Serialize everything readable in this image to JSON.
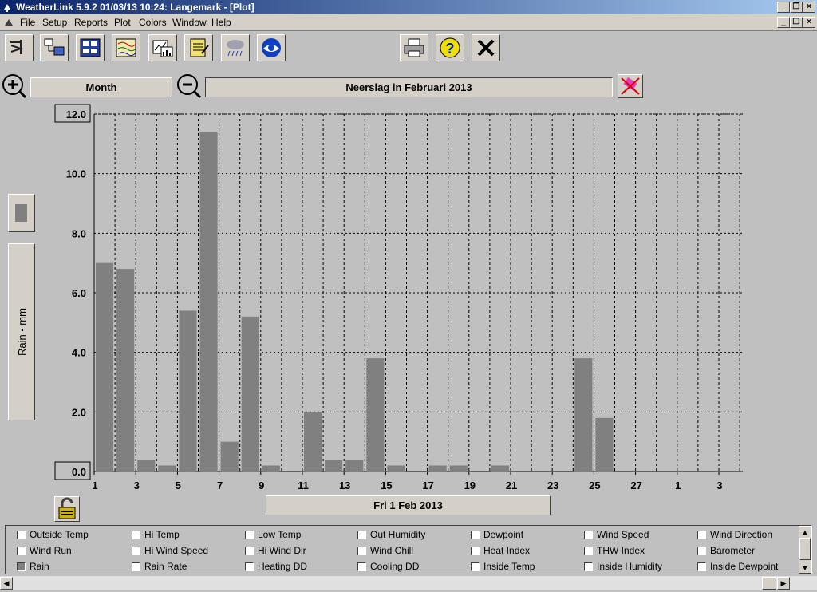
{
  "window": {
    "title": "WeatherLink 5.9.2  01/03/13  10:24: Langemark - [Plot]"
  },
  "menu": [
    "File",
    "Setup",
    "Reports",
    "Plot",
    "Colors",
    "Window",
    "Help"
  ],
  "toolbar": {
    "icons": [
      "station-icon",
      "setup-icon",
      "bulletin-icon",
      "strip-chart-icon",
      "plot-icon",
      "notes-icon",
      "rain-icon",
      "noaa-icon",
      "print-icon",
      "help-icon",
      "close-icon"
    ]
  },
  "plot": {
    "period": "Month",
    "title": "Neerslag in Februari 2013",
    "date_label": "Fri 1 Feb 2013",
    "ylabel": "Rain - mm"
  },
  "chart_data": {
    "type": "bar",
    "title": "Neerslag in Februari 2013",
    "ylabel": "Rain - mm",
    "xlabel": "Fri 1 Feb 2013",
    "ylim": [
      0,
      12
    ],
    "y_ticks": [
      "0.0",
      "2.0",
      "4.0",
      "6.0",
      "8.0",
      "10.0",
      "12.0"
    ],
    "x_ticks": [
      "1",
      "3",
      "5",
      "7",
      "9",
      "11",
      "13",
      "15",
      "17",
      "19",
      "21",
      "23",
      "25",
      "27",
      "1",
      "3"
    ],
    "values": [
      7.0,
      6.8,
      0.4,
      0.2,
      5.4,
      11.4,
      1.0,
      5.2,
      0.2,
      0.0,
      2.0,
      0.4,
      0.4,
      3.8,
      0.2,
      0.0,
      0.2,
      0.2,
      0.0,
      0.2,
      0.0,
      0.0,
      0.0,
      3.8,
      1.8,
      0.0,
      0.0,
      0.0,
      0.0,
      0.0,
      0.0
    ],
    "bar_color": "#808080",
    "grid": true
  },
  "series_options": [
    {
      "label": "Outside Temp",
      "checked": false
    },
    {
      "label": "Hi Temp",
      "checked": false
    },
    {
      "label": "Low Temp",
      "checked": false
    },
    {
      "label": "Out Humidity",
      "checked": false
    },
    {
      "label": "Dewpoint",
      "checked": false
    },
    {
      "label": "Wind Speed",
      "checked": false
    },
    {
      "label": "Wind Direction",
      "checked": false
    },
    {
      "label": "Wind Run",
      "checked": false
    },
    {
      "label": "Hi Wind Speed",
      "checked": false
    },
    {
      "label": "Hi Wind Dir",
      "checked": false
    },
    {
      "label": "Wind Chill",
      "checked": false
    },
    {
      "label": "Heat Index",
      "checked": false
    },
    {
      "label": "THW Index",
      "checked": false
    },
    {
      "label": "Barometer",
      "checked": false
    },
    {
      "label": "Rain",
      "checked": true
    },
    {
      "label": "Rain Rate",
      "checked": false
    },
    {
      "label": "Heating DD",
      "checked": false
    },
    {
      "label": "Cooling DD",
      "checked": false
    },
    {
      "label": "Inside Temp",
      "checked": false
    },
    {
      "label": "Inside Humidity",
      "checked": false
    },
    {
      "label": "Inside Dewpoint",
      "checked": false
    }
  ]
}
